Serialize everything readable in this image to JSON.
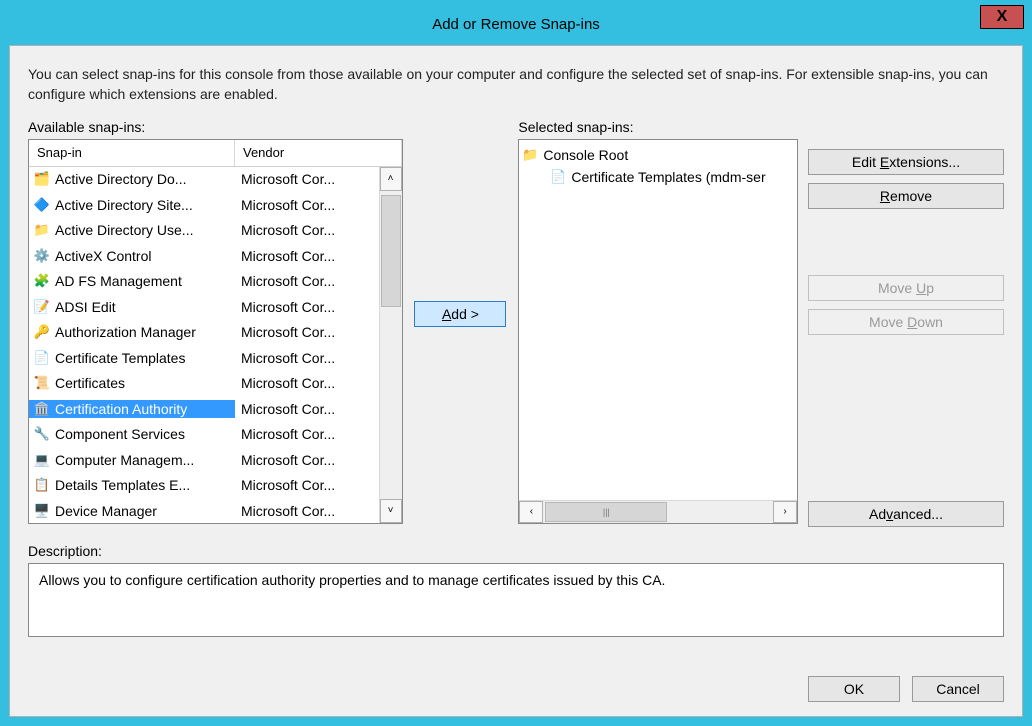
{
  "window": {
    "title": "Add or Remove Snap-ins",
    "close_glyph": "X"
  },
  "intro": "You can select snap-ins for this console from those available on your computer and configure the selected set of snap-ins. For extensible snap-ins, you can configure which extensions are enabled.",
  "available_label": "Available snap-ins:",
  "selected_label": "Selected snap-ins:",
  "headers": {
    "snapin": "Snap-in",
    "vendor": "Vendor"
  },
  "add_label": "Add >",
  "buttons": {
    "edit_ext": "Edit Extensions...",
    "remove": "Remove",
    "move_up": "Move Up",
    "move_down": "Move Down",
    "advanced": "Advanced...",
    "ok": "OK",
    "cancel": "Cancel"
  },
  "underline": {
    "add": "A",
    "edit_ext": "E",
    "remove": "R",
    "move_up": "U",
    "move_down": "D",
    "advanced": "v"
  },
  "snapins": [
    {
      "name": "Active Directory Do...",
      "vendor": "Microsoft Cor...",
      "icon": "🗂️"
    },
    {
      "name": "Active Directory Site...",
      "vendor": "Microsoft Cor...",
      "icon": "🔷"
    },
    {
      "name": "Active Directory Use...",
      "vendor": "Microsoft Cor...",
      "icon": "📁"
    },
    {
      "name": "ActiveX Control",
      "vendor": "Microsoft Cor...",
      "icon": "⚙️"
    },
    {
      "name": "AD FS Management",
      "vendor": "Microsoft Cor...",
      "icon": "🧩"
    },
    {
      "name": "ADSI Edit",
      "vendor": "Microsoft Cor...",
      "icon": "📝"
    },
    {
      "name": "Authorization Manager",
      "vendor": "Microsoft Cor...",
      "icon": "🔑"
    },
    {
      "name": "Certificate Templates",
      "vendor": "Microsoft Cor...",
      "icon": "📄"
    },
    {
      "name": "Certificates",
      "vendor": "Microsoft Cor...",
      "icon": "📜"
    },
    {
      "name": "Certification Authority",
      "vendor": "Microsoft Cor...",
      "icon": "🏛️",
      "selected": true
    },
    {
      "name": "Component Services",
      "vendor": "Microsoft Cor...",
      "icon": "🔧"
    },
    {
      "name": "Computer Managem...",
      "vendor": "Microsoft Cor...",
      "icon": "💻"
    },
    {
      "name": "Details Templates E...",
      "vendor": "Microsoft Cor...",
      "icon": "📋"
    },
    {
      "name": "Device Manager",
      "vendor": "Microsoft Cor...",
      "icon": "🖥️"
    }
  ],
  "tree": {
    "root": "Console Root",
    "child": "Certificate Templates (mdm-ser",
    "root_icon": "📁",
    "child_icon": "📄"
  },
  "description_label": "Description:",
  "description_text": "Allows you to configure certification authority  properties and to manage certificates issued by this CA.",
  "scroll": {
    "up": "˄",
    "down": "˅",
    "left": "‹",
    "right": "›",
    "grip": "|||"
  }
}
